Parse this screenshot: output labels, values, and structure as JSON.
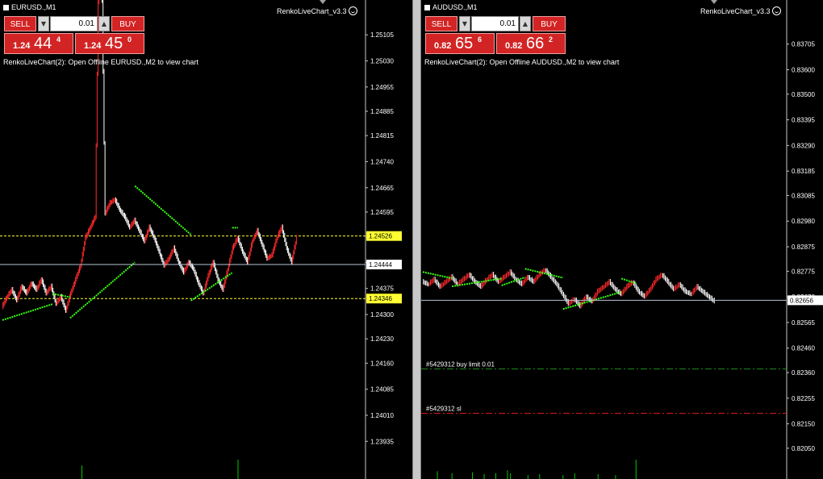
{
  "colors": {
    "bull": "#ff2a2a",
    "bear": "#ffffff",
    "trend": "#39ff14",
    "hline": "#ffff33",
    "bid": "#b8c4d4",
    "volume": "#00c800",
    "buy_limit": "#1a8a1a",
    "stop_loss": "#d81818",
    "price_box": "#d22424"
  },
  "icons": {
    "smiley": "smiley-icon",
    "spin_up": "arrow-up-icon",
    "spin_down": "arrow-down-icon"
  },
  "charts": [
    {
      "title": "EURUSD.,M1",
      "indicator": "RenkoLiveChart_v3.3",
      "trade": {
        "sell": "SELL",
        "buy": "BUY",
        "volume": "0.01",
        "bid_small": "1.24",
        "bid_big": "44",
        "bid_sup": "4",
        "ask_small": "1.24",
        "ask_big": "45",
        "ask_sup": "0"
      },
      "comment": "RenkoLiveChart(2): Open Offline EURUSD.,M2 to view chart",
      "axis_min": 1.2388,
      "axis_max": 1.25145,
      "ticks": [
        "1.25105",
        "1.25030",
        "1.24955",
        "1.24885",
        "1.24815",
        "1.24740",
        "1.24665",
        "1.24595",
        "1.24525",
        "1.24450",
        "1.24375",
        "1.24300",
        "1.24230",
        "1.24160",
        "1.24085",
        "1.24010",
        "1.23935"
      ],
      "hlines": [
        {
          "value": 1.24526,
          "label": "1.24526",
          "kind": "yellow"
        },
        {
          "value": 1.24346,
          "label": "1.24346",
          "kind": "yellow"
        }
      ],
      "bid": {
        "value": 1.24444,
        "label": "1.24444"
      },
      "orders": [],
      "path": [
        1.2432,
        1.2435,
        1.2437,
        1.2434,
        1.2438,
        1.2436,
        1.2439,
        1.2437,
        1.244,
        1.2436,
        1.2438,
        1.2433,
        1.2435,
        1.2431,
        1.2436,
        1.244,
        1.2444,
        1.2452,
        1.2455,
        1.2458,
        1.2561,
        1.2459,
        1.2462,
        1.2463,
        1.246,
        1.2458,
        1.2455,
        1.2457,
        1.2454,
        1.2451,
        1.2455,
        1.2452,
        1.2448,
        1.2444,
        1.2446,
        1.2449,
        1.2445,
        1.2442,
        1.2445,
        1.2443,
        1.2439,
        1.2436,
        1.2441,
        1.2445,
        1.244,
        1.2437,
        1.2443,
        1.2449,
        1.2452,
        1.2448,
        1.2445,
        1.2451,
        1.2454,
        1.245,
        1.2446,
        1.2447,
        1.2452,
        1.2455,
        1.2449,
        1.2445,
        1.2452
      ],
      "trend": [
        {
          "from": [
            1.24284,
            0
          ],
          "to": [
            1.2433,
            0.17
          ]
        },
        {
          "from": [
            1.2436,
            0.17
          ],
          "to": [
            1.2435,
            0.23
          ]
        },
        {
          "from": [
            1.2429,
            0.23
          ],
          "to": [
            1.2445,
            0.45
          ]
        },
        {
          "from": [
            1.2467,
            0.45
          ],
          "to": [
            1.2453,
            0.64
          ]
        },
        {
          "from": [
            1.2434,
            0.64
          ],
          "to": [
            1.2442,
            0.78
          ]
        },
        {
          "from": [
            1.2455,
            0.78
          ],
          "to": [
            1.2455,
            0.8
          ]
        }
      ],
      "volumes": [
        {
          "at": 0.27,
          "v": 0.7
        },
        {
          "at": 0.8,
          "v": 1.0
        }
      ]
    },
    {
      "title": "AUDUSD.,M1",
      "indicator": "RenkoLiveChart_v3.3",
      "trade": {
        "sell": "SELL",
        "buy": "BUY",
        "volume": "0.01",
        "bid_small": "0.82",
        "bid_big": "65",
        "bid_sup": "6",
        "ask_small": "0.82",
        "ask_big": "66",
        "ask_sup": "2"
      },
      "comment": "RenkoLiveChart(2): Open Offline AUDUSD.,M2 to view chart",
      "axis_min": 0.82,
      "axis_max": 0.8378,
      "ticks": [
        "0.83705",
        "0.83600",
        "0.83500",
        "0.83395",
        "0.83290",
        "0.83185",
        "0.83085",
        "0.82980",
        "0.82875",
        "0.82775",
        "0.82670",
        "0.82565",
        "0.82460",
        "0.82360",
        "0.82255",
        "0.82150",
        "0.82050"
      ],
      "hlines": [],
      "bid": {
        "value": 0.82656,
        "label": "0.82656"
      },
      "orders": [
        {
          "value": 0.82375,
          "label": "#5429312 buy limit 0.01",
          "kind": "buy"
        },
        {
          "value": 0.82193,
          "label": "#5429312 sl",
          "kind": "sl"
        }
      ],
      "path": [
        0.8273,
        0.8272,
        0.8274,
        0.8271,
        0.8273,
        0.8275,
        0.8272,
        0.8274,
        0.8276,
        0.8273,
        0.8271,
        0.8274,
        0.8276,
        0.8273,
        0.8275,
        0.8277,
        0.8274,
        0.8272,
        0.8275,
        0.8273,
        0.8276,
        0.8278,
        0.8275,
        0.8272,
        0.8268,
        0.8264,
        0.8266,
        0.8263,
        0.8267,
        0.8265,
        0.8269,
        0.8271,
        0.8273,
        0.827,
        0.8268,
        0.8271,
        0.8273,
        0.8269,
        0.8267,
        0.827,
        0.8274,
        0.8276,
        0.8273,
        0.827,
        0.8272,
        0.8269,
        0.8268,
        0.8271,
        0.8269,
        0.8267,
        0.8265
      ],
      "trend": [
        {
          "from": [
            0.82772,
            0
          ],
          "to": [
            0.82746,
            0.1
          ]
        },
        {
          "from": [
            0.82713,
            0.1
          ],
          "to": [
            0.82745,
            0.27
          ]
        },
        {
          "from": [
            0.82717,
            0.27
          ],
          "to": [
            0.8275,
            0.35
          ]
        },
        {
          "from": [
            0.82785,
            0.35
          ],
          "to": [
            0.82748,
            0.48
          ]
        },
        {
          "from": [
            0.8262,
            0.48
          ],
          "to": [
            0.8269,
            0.68
          ]
        },
        {
          "from": [
            0.82745,
            0.68
          ],
          "to": [
            0.82725,
            0.73
          ]
        }
      ],
      "volumes": [
        {
          "at": 0.05,
          "v": 0.4
        },
        {
          "at": 0.1,
          "v": 0.3
        },
        {
          "at": 0.17,
          "v": 0.35
        },
        {
          "at": 0.21,
          "v": 0.25
        },
        {
          "at": 0.25,
          "v": 0.3
        },
        {
          "at": 0.29,
          "v": 0.45
        },
        {
          "at": 0.3,
          "v": 0.3
        },
        {
          "at": 0.36,
          "v": 0.2
        },
        {
          "at": 0.4,
          "v": 0.25
        },
        {
          "at": 0.48,
          "v": 0.2
        },
        {
          "at": 0.52,
          "v": 0.3
        },
        {
          "at": 0.6,
          "v": 0.25
        },
        {
          "at": 0.66,
          "v": 0.2
        },
        {
          "at": 0.73,
          "v": 1.0
        }
      ]
    }
  ]
}
